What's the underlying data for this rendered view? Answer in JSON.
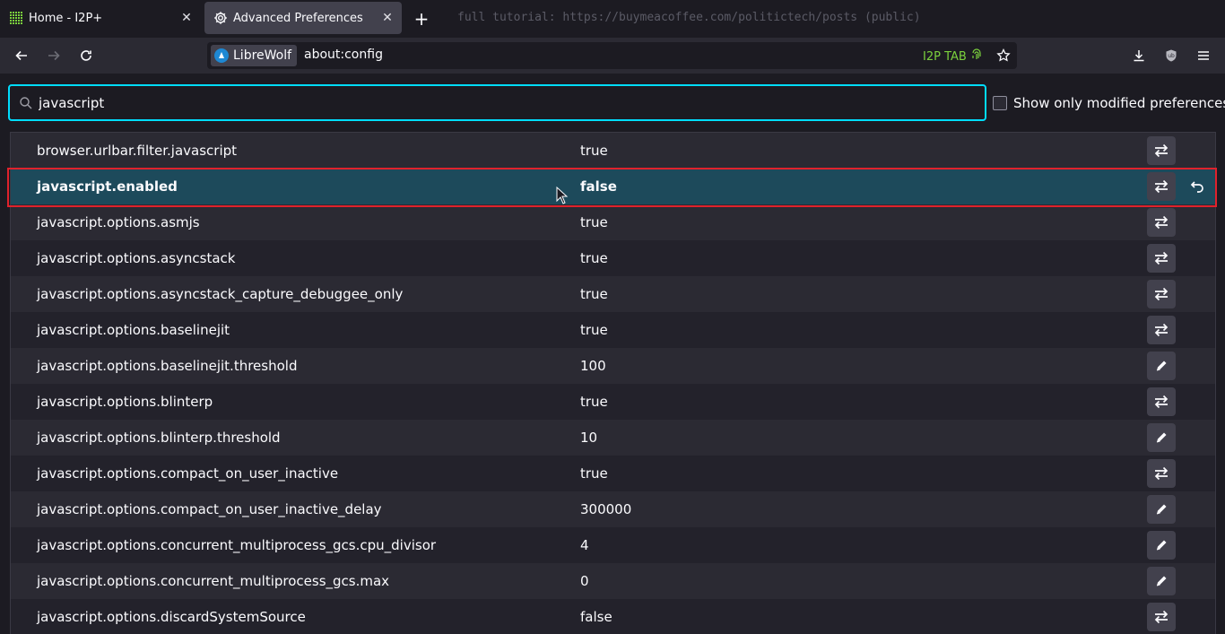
{
  "tabs": [
    {
      "title": "Home - I2P+",
      "icon": "grid-icon"
    },
    {
      "title": "Advanced Preferences",
      "icon": "gear-icon"
    }
  ],
  "tab_note": "full tutorial: https://buymeacoffee.com/politictech/posts (public)",
  "urlbar": {
    "identity": "LibreWolf",
    "url": "about:config",
    "i2p_badge": "I2P TAB"
  },
  "search": {
    "value": "javascript"
  },
  "show_modified_label": "Show only modified preferences",
  "prefs": [
    {
      "name": "browser.urlbar.filter.javascript",
      "value": "true",
      "type": "toggle"
    },
    {
      "name": "javascript.enabled",
      "value": "false",
      "type": "toggle",
      "modified": true
    },
    {
      "name": "javascript.options.asmjs",
      "value": "true",
      "type": "toggle"
    },
    {
      "name": "javascript.options.asyncstack",
      "value": "true",
      "type": "toggle"
    },
    {
      "name": "javascript.options.asyncstack_capture_debuggee_only",
      "value": "true",
      "type": "toggle"
    },
    {
      "name": "javascript.options.baselinejit",
      "value": "true",
      "type": "toggle"
    },
    {
      "name": "javascript.options.baselinejit.threshold",
      "value": "100",
      "type": "edit"
    },
    {
      "name": "javascript.options.blinterp",
      "value": "true",
      "type": "toggle"
    },
    {
      "name": "javascript.options.blinterp.threshold",
      "value": "10",
      "type": "edit"
    },
    {
      "name": "javascript.options.compact_on_user_inactive",
      "value": "true",
      "type": "toggle"
    },
    {
      "name": "javascript.options.compact_on_user_inactive_delay",
      "value": "300000",
      "type": "edit"
    },
    {
      "name": "javascript.options.concurrent_multiprocess_gcs.cpu_divisor",
      "value": "4",
      "type": "edit"
    },
    {
      "name": "javascript.options.concurrent_multiprocess_gcs.max",
      "value": "0",
      "type": "edit"
    },
    {
      "name": "javascript.options.discardSystemSource",
      "value": "false",
      "type": "toggle"
    }
  ],
  "colors": {
    "accent": "#00ddff",
    "selected_row": "#1d4a5b",
    "highlight": "#e0222c",
    "i2p": "#7bd13d"
  }
}
